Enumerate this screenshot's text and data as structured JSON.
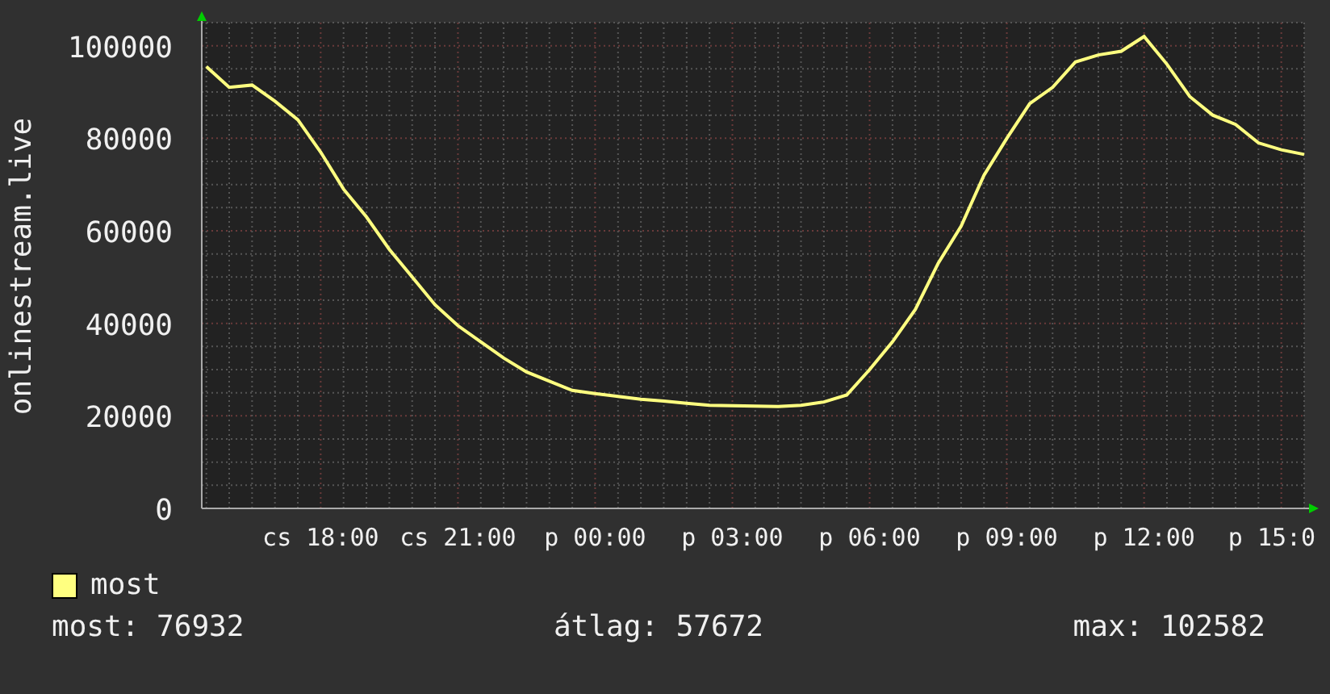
{
  "chart": {
    "chart_data": {
      "type": "line",
      "ylabel": "onlinestream.live",
      "categories": [
        null,
        null,
        null,
        null,
        null,
        "cs 18:00",
        null,
        null,
        null,
        null,
        null,
        "cs 21:00",
        null,
        null,
        null,
        null,
        null,
        "p 00:00",
        null,
        null,
        null,
        null,
        null,
        "p 03:00",
        null,
        null,
        null,
        null,
        null,
        "p 06:00",
        null,
        null,
        null,
        null,
        null,
        "p 09:00",
        null,
        null,
        null,
        null,
        null,
        "p 12:00",
        null,
        null,
        null,
        null,
        null,
        "p 15:0",
        null
      ],
      "series": [
        {
          "color": "#ffff80",
          "values": [
            95500,
            91000,
            91500,
            88000,
            84000,
            77000,
            69000,
            63000,
            56000,
            50000,
            44000,
            39500,
            36000,
            32500,
            29500,
            27500,
            25500,
            24800,
            24200,
            23600,
            23200,
            22700,
            22300,
            22200,
            22100,
            22000,
            22300,
            23000,
            24500,
            30000,
            36000,
            43000,
            53000,
            61000,
            72000,
            80000,
            87500,
            91000,
            96500,
            98000,
            98800,
            102000,
            96000,
            89000,
            85000,
            83000,
            79000,
            77500,
            76500
          ]
        }
      ],
      "grid": true,
      "ylim": [
        0,
        105000
      ],
      "yticks": [
        {
          "value": 0,
          "label": "0"
        },
        {
          "value": 20000,
          "label": "20000"
        },
        {
          "value": 40000,
          "label": "40000"
        },
        {
          "value": 60000,
          "label": "60000"
        },
        {
          "value": 80000,
          "label": "80000"
        },
        {
          "value": 100000,
          "label": "100000"
        }
      ]
    }
  },
  "legend": [
    {
      "label": "most",
      "color": "#ffff80"
    }
  ],
  "stats": [
    {
      "label": "most: 76932"
    },
    {
      "label": "átlag: 57672"
    },
    {
      "label": "max: 102582"
    }
  ]
}
